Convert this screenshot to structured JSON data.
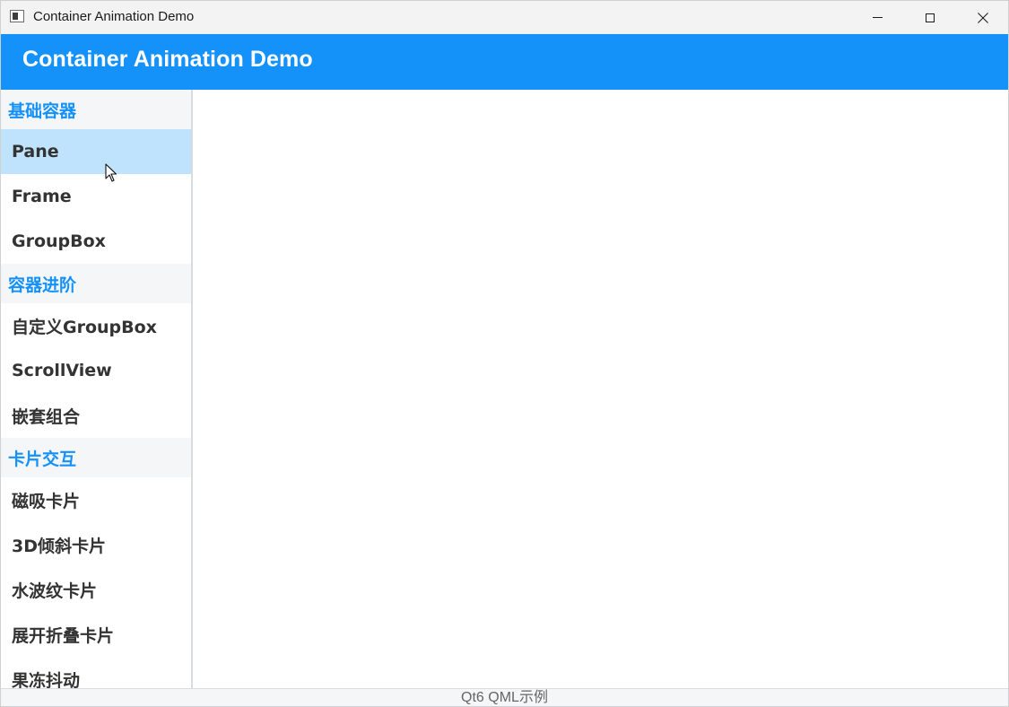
{
  "window": {
    "title": "Container Animation Demo",
    "icons": {
      "minimize": "minimize-icon",
      "maximize": "maximize-icon",
      "close": "close-icon"
    }
  },
  "header": {
    "title": "Container Animation Demo",
    "background_color": "#1591fa"
  },
  "sidebar": {
    "accent_color": "#1591fa",
    "active_item_background": "#bfe3fd",
    "groups": [
      {
        "label": "基础容器",
        "items": [
          {
            "label": "Pane",
            "selected": true
          },
          {
            "label": "Frame"
          },
          {
            "label": "GroupBox"
          }
        ]
      },
      {
        "label": "容器进阶",
        "items": [
          {
            "label": "自定义GroupBox"
          },
          {
            "label": "ScrollView"
          },
          {
            "label": "嵌套组合"
          }
        ]
      },
      {
        "label": "卡片交互",
        "items": [
          {
            "label": "磁吸卡片"
          },
          {
            "label": "3D倾斜卡片"
          },
          {
            "label": "水波纹卡片"
          },
          {
            "label": "展开折叠卡片"
          },
          {
            "label": "果冻抖动"
          }
        ]
      }
    ]
  },
  "footer": {
    "text": "Qt6 QML示例"
  }
}
